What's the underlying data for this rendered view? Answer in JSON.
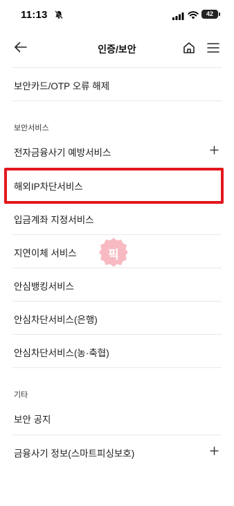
{
  "status": {
    "time": "11:13",
    "battery": "42"
  },
  "header": {
    "title": "인증/보안",
    "back_icon": "arrow-left-icon",
    "home_icon": "home-icon",
    "menu_icon": "hamburger-menu-icon"
  },
  "top_item": {
    "label": "보안카드/OTP 오류 해제"
  },
  "sections": {
    "security": {
      "title": "보안서비스",
      "items": [
        {
          "label": "전자금융사기 예방서비스",
          "expandable": true
        },
        {
          "label": "해외IP차단서비스",
          "highlighted": true
        },
        {
          "label": "입금계좌 지정서비스"
        },
        {
          "label": "지연이체 서비스"
        },
        {
          "label": "안심뱅킹서비스"
        },
        {
          "label": "안심차단서비스(은행)"
        },
        {
          "label": "안심차단서비스(농·축협)"
        }
      ]
    },
    "etc": {
      "title": "기타",
      "items": [
        {
          "label": "보안 공지"
        },
        {
          "label": "금융사기 정보(스마트피싱보호)",
          "expandable": true
        }
      ]
    }
  },
  "watermark": {
    "text": "픽",
    "color": "#f4a3ad"
  },
  "colors": {
    "highlight": "#e3171e",
    "divider": "#e8e8e8"
  }
}
